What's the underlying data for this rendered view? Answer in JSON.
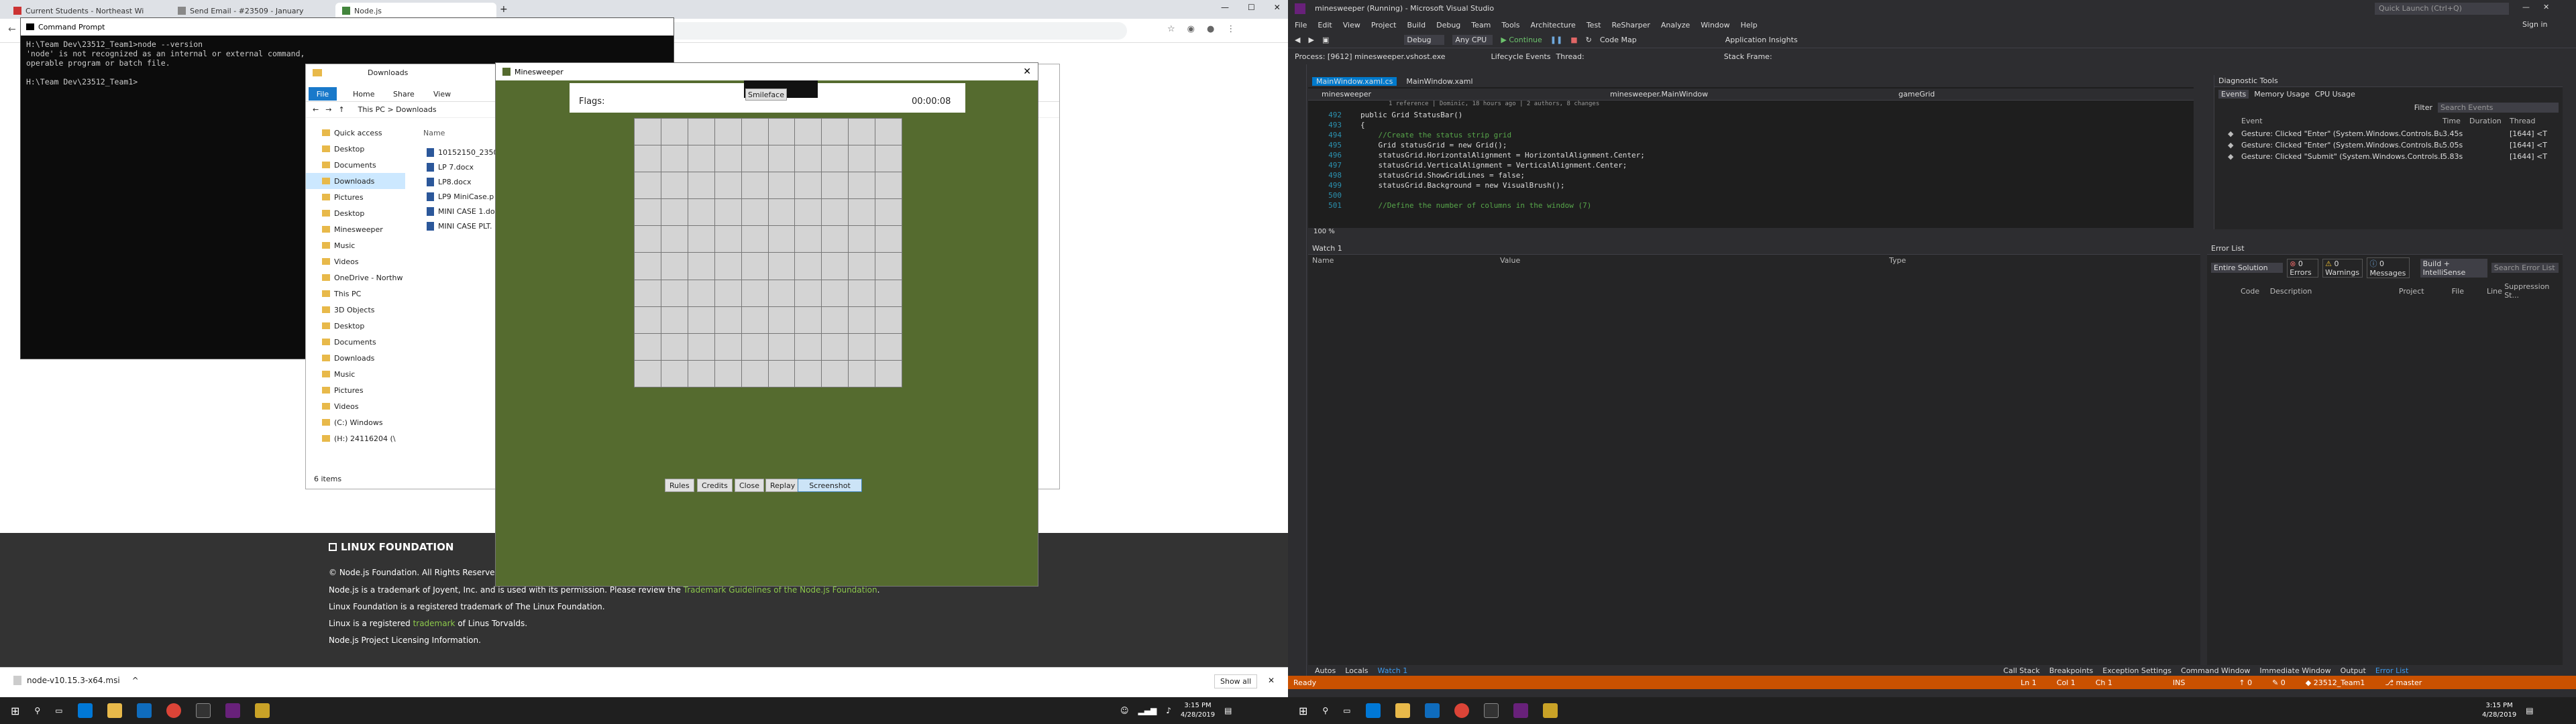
{
  "chrome": {
    "tabs": [
      {
        "label": "Current Students - Northeast Wi"
      },
      {
        "label": "Send Email - #23509 - January"
      },
      {
        "label": "Node.js"
      }
    ],
    "new_tab": "+"
  },
  "node_site": {
    "footer_logo": "LINUX FOUNDATION",
    "copyright": "© Node.js Foundation. All Rights Reserved.",
    "line1_pre": "Node.js is a trademark of Joyent, Inc. and is used with its permission. Please review the",
    "line1_link": "Trademark Guidelines of the Node.js Foundation",
    "line2": "Linux Foundation is a registered trademark of The Linux Foundation.",
    "line3_pre": "Linux is a registered",
    "line3_link": "trademark",
    "line3_post": "of Linus Torvalds.",
    "line4": "Node.js Project Licensing Information."
  },
  "download_bar": {
    "file": "node-v10.15.3-x64.msi",
    "show_all": "Show all"
  },
  "cmd": {
    "title": "Command Prompt",
    "lines": "H:\\Team Dev\\23512_Team1>node --version\n'node' is not recognized as an internal or external command,\noperable program or batch file.\n\nH:\\Team Dev\\23512_Team1>"
  },
  "explorer": {
    "title": "Downloads",
    "ribbon": [
      "File",
      "Home",
      "Share",
      "View"
    ],
    "path": [
      "This PC",
      "Downloads"
    ],
    "column_name": "Name",
    "sidebar": [
      "Quick access",
      "Desktop",
      "Documents",
      "Downloads",
      "Pictures",
      "Desktop",
      "Minesweeper",
      "Music",
      "Videos",
      "OneDrive - Northw",
      "This PC",
      "3D Objects",
      "Desktop",
      "Documents",
      "Downloads",
      "Music",
      "Pictures",
      "Videos",
      "(C:) Windows",
      "(H:) 24116204 (\\"
    ],
    "files": [
      "10152150_23509",
      "LP 7.docx",
      "LP8.docx",
      "LP9 MiniCase.p",
      "MINI CASE 1.do",
      "MINI CASE PLT."
    ],
    "count": "6 items"
  },
  "mines": {
    "title": "Minesweeper",
    "flags": "Flags:",
    "smiley": "Smileface",
    "timer": "00:00:08",
    "buttons": [
      "Rules",
      "Credits",
      "Close",
      "Replay",
      "Screenshot"
    ]
  },
  "vs": {
    "title": "minesweeper (Running) - Microsoft Visual Studio",
    "quick_launch": "Quick Launch (Ctrl+Q)",
    "sign_in": "Sign in",
    "menu": [
      "File",
      "Edit",
      "View",
      "Project",
      "Build",
      "Debug",
      "Team",
      "Tools",
      "Architecture",
      "Test",
      "ReSharper",
      "Analyze",
      "Window",
      "Help"
    ],
    "toolbar": [
      "Debug",
      "Any CPU",
      "Continue",
      "Code Map",
      "Application Insights"
    ],
    "process": "Process: [9612] minesweeper.vshost.exe",
    "lifecycle": "Lifecycle Events",
    "thread": "Thread:",
    "stack": "Stack Frame:",
    "tabs": [
      "MainWindow.xaml.cs",
      "MainWindow.xaml"
    ],
    "nav": [
      "minesweeper",
      "minesweeper.MainWindow",
      "gameGrid"
    ],
    "ref_line": "1 reference | Dominic, 18 hours ago | 2 authors, 8 changes",
    "code": [
      {
        "ln": "492",
        "text": "public Grid StatusBar()"
      },
      {
        "ln": "493",
        "text": "{"
      },
      {
        "ln": "494",
        "text": "    //Create the status strip grid"
      },
      {
        "ln": "495",
        "text": "    Grid statusGrid = new Grid();"
      },
      {
        "ln": "496",
        "text": "    statusGrid.HorizontalAlignment = HorizontalAlignment.Center;"
      },
      {
        "ln": "497",
        "text": "    statusGrid.VerticalAlignment = VerticalAlignment.Center;"
      },
      {
        "ln": "498",
        "text": "    statusGrid.ShowGridLines = false;"
      },
      {
        "ln": "499",
        "text": "    statusGrid.Background = new VisualBrush();"
      },
      {
        "ln": "500",
        "text": ""
      },
      {
        "ln": "501",
        "text": "    //Define the number of columns in the window (7)"
      }
    ],
    "zoom": "100 %",
    "diag": {
      "title": "Diagnostic Tools",
      "tabs": [
        "Events",
        "Memory Usage",
        "CPU Usage"
      ],
      "filter": "Filter",
      "search": "Search Events",
      "cols": [
        "Event",
        "Time",
        "Duration",
        "Thread"
      ],
      "rows": [
        {
          "ev": "Gesture: Clicked \"Enter\" (System.Windows.Controls.But...",
          "time": "3.45s",
          "thread": "[1644] <T"
        },
        {
          "ev": "Gesture: Clicked \"Enter\" (System.Windows.Controls.But...",
          "time": "5.05s",
          "thread": "[1644] <T"
        },
        {
          "ev": "Gesture: Clicked \"Submit\" (System.Windows.Controls.B...",
          "time": "5.83s",
          "thread": "[1644] <T"
        }
      ]
    },
    "watch": {
      "title": "Watch 1",
      "cols": [
        "Name",
        "Value",
        "Type"
      ]
    },
    "errors": {
      "title": "Error List",
      "scope": "Entire Solution",
      "errors": "0 Errors",
      "warnings": "0 Warnings",
      "messages": "0 Messages",
      "build": "Build + IntelliSense",
      "search": "Search Error List",
      "cols": [
        "Code",
        "Description",
        "Project",
        "File",
        "Line",
        "Suppression St..."
      ]
    },
    "bottom_left": [
      "Autos",
      "Locals",
      "Watch 1"
    ],
    "bottom_right": [
      "Call Stack",
      "Breakpoints",
      "Exception Settings",
      "Command Window",
      "Immediate Window",
      "Output",
      "Error List"
    ],
    "status": {
      "ready": "Ready",
      "ln": "Ln 1",
      "col": "Col 1",
      "ch": "Ch 1",
      "ins": "INS",
      "branch_up": "0",
      "pending": "0",
      "repo": "23512_Team1",
      "branch": "master"
    }
  },
  "taskbar": {
    "time": "3:15 PM",
    "date": "4/28/2019"
  }
}
